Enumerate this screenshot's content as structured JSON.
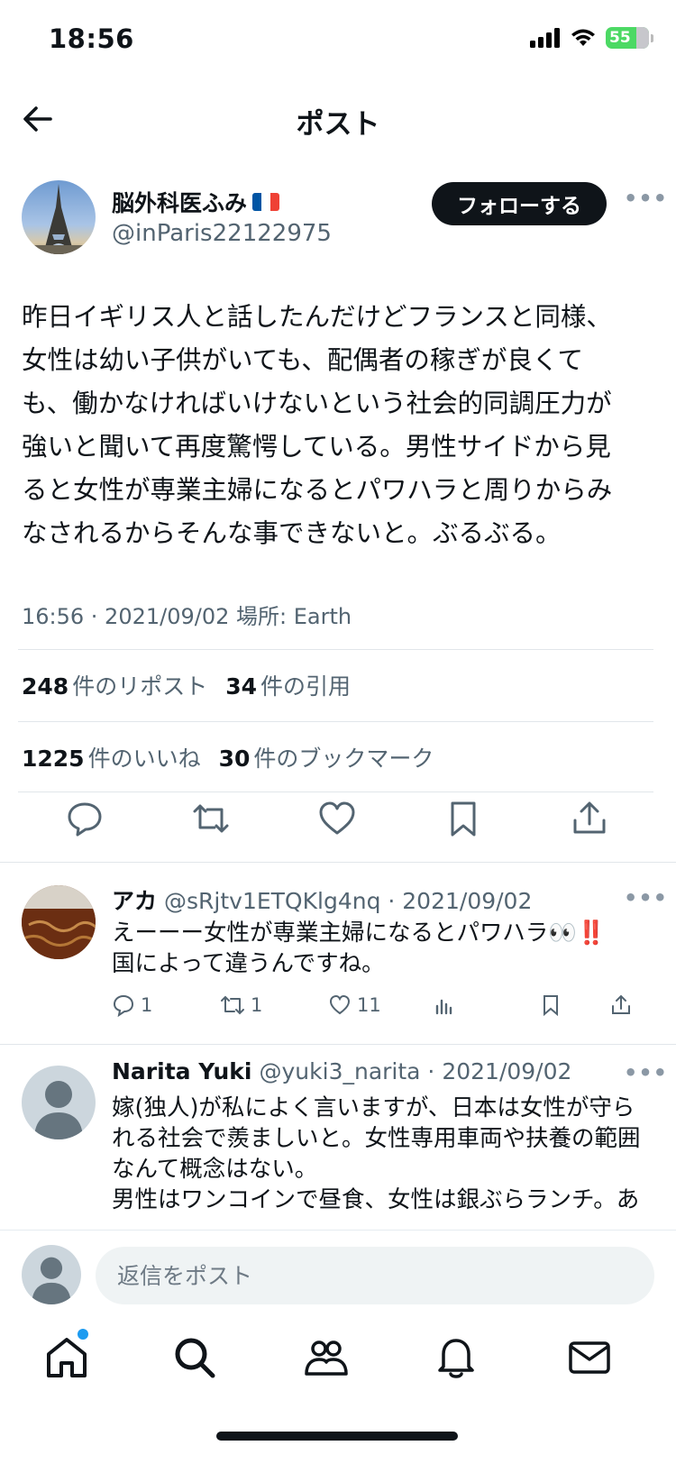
{
  "status_bar": {
    "time": "18:56",
    "battery": "55"
  },
  "header": {
    "title": "ポスト"
  },
  "post": {
    "author_name": "脳外科医ふみ",
    "author_handle": "@inParis22122975",
    "follow_label": "フォローする",
    "text": "昨日イギリス人と話したんだけどフランスと同様、\n女性は幼い子供がいても、配偶者の稼ぎが良くて\nも、働かなければいけないという社会的同調圧力が\n強いと聞いて再度驚愕している。男性サイドから見\nると女性が専業主婦になるとパワハラと周りからみ\nなされるからそんな事できないと。ぶるぶる。",
    "meta": "16:56 · 2021/09/02 場所: Earth",
    "stats_row1": [
      {
        "num": "248",
        "label": "件のリポスト"
      },
      {
        "num": "34",
        "label": "件の引用"
      }
    ],
    "stats_row2": [
      {
        "num": "1225",
        "label": "件のいいね"
      },
      {
        "num": "30",
        "label": "件のブックマーク"
      }
    ]
  },
  "replies": [
    {
      "name": "アカ",
      "handle": "@sRjtv1ETQKlg4nq · 2021/09/02",
      "text": "えーーー女性が専業主婦になるとパワハラ👀‼️\n国によって違うんですね。",
      "replies": "1",
      "reposts": "1",
      "likes": "11"
    },
    {
      "name": "Narita Yuki",
      "handle": "@yuki3_narita · 2021/09/02",
      "text": "嫁(独人)が私によく言いますが、日本は女性が守ら\nれる社会で羨ましいと。女性専用車両や扶養の範囲\nなんて概念はない。\n男性はワンコインで昼食、女性は銀ぶらランチ。あ"
    }
  ],
  "composer": {
    "placeholder": "返信をポスト"
  },
  "colors": {
    "accent": "#1d9bf0",
    "text": "#0f1419",
    "muted": "#536471"
  }
}
